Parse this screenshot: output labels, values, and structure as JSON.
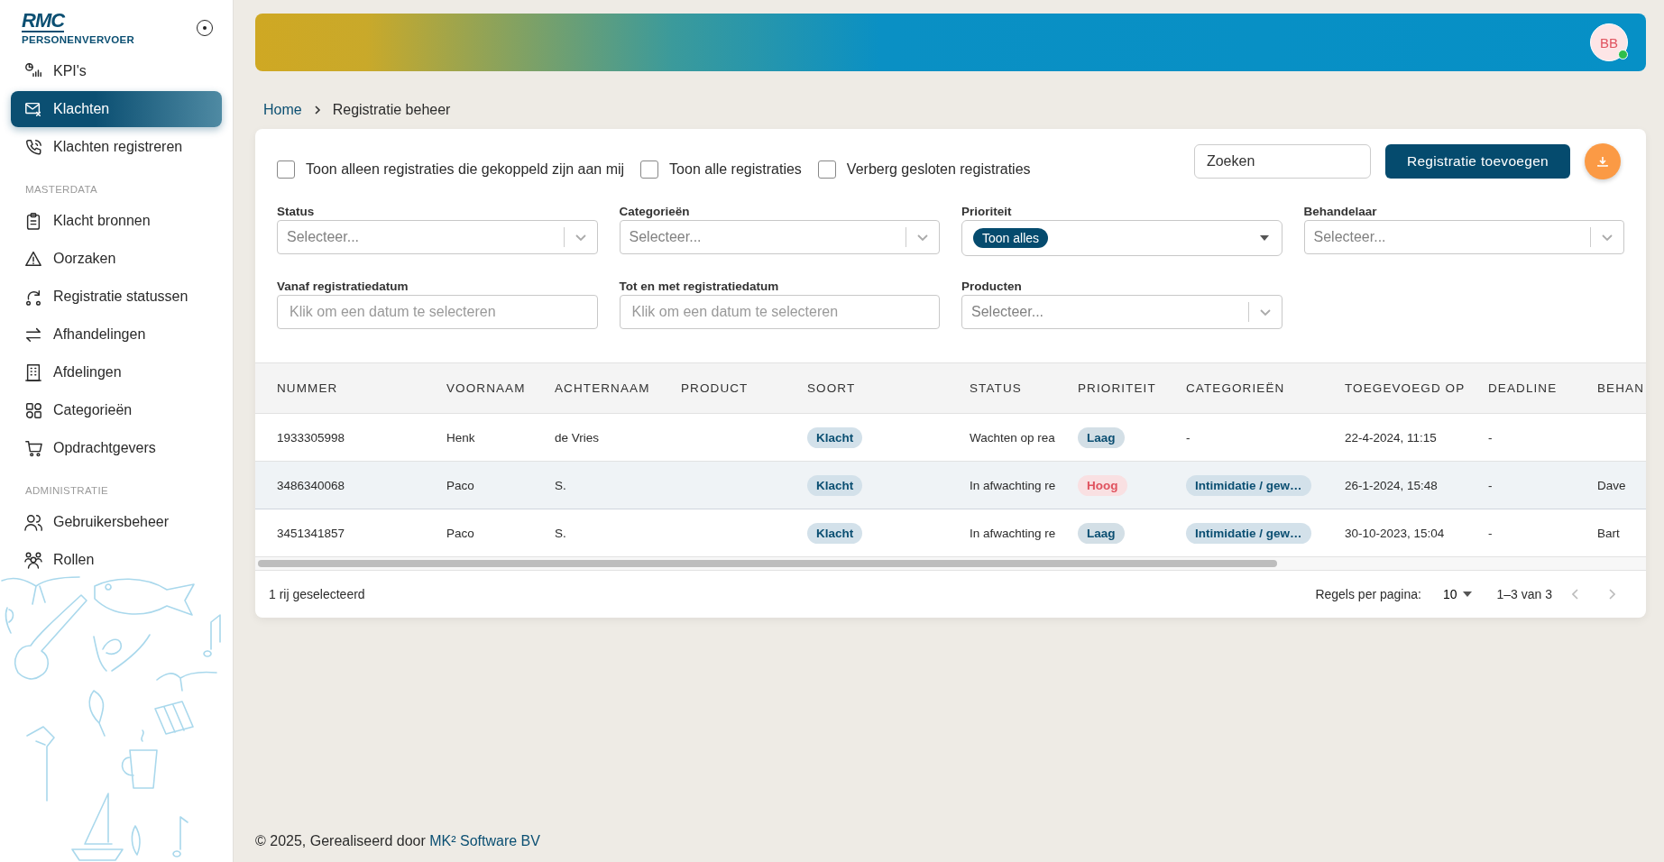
{
  "sidebar": {
    "logo": {
      "title": "RMC",
      "subtitle": "PERSONENVERVOER"
    },
    "nav": [
      {
        "kind": "item",
        "label": "KPI's",
        "selected": false
      },
      {
        "kind": "item",
        "label": "Klachten",
        "selected": true
      },
      {
        "kind": "item",
        "label": "Klachten registreren",
        "selected": false
      },
      {
        "kind": "heading",
        "label": "MASTERDATA"
      },
      {
        "kind": "item",
        "label": "Klacht bronnen",
        "selected": false
      },
      {
        "kind": "item",
        "label": "Oorzaken",
        "selected": false
      },
      {
        "kind": "item",
        "label": "Registratie statussen",
        "selected": false
      },
      {
        "kind": "item",
        "label": "Afhandelingen",
        "selected": false
      },
      {
        "kind": "item",
        "label": "Afdelingen",
        "selected": false
      },
      {
        "kind": "item",
        "label": "Categorieën",
        "selected": false
      },
      {
        "kind": "item",
        "label": "Opdrachtgevers",
        "selected": false
      },
      {
        "kind": "heading",
        "label": "ADMINISTRATIE"
      },
      {
        "kind": "item",
        "label": "Gebruikersbeheer",
        "selected": false
      },
      {
        "kind": "item",
        "label": "Rollen",
        "selected": false
      }
    ]
  },
  "header": {
    "avatar": {
      "initials": "BB",
      "online": true
    }
  },
  "breadcrumb": {
    "home": "Home",
    "current": "Registratie beheer"
  },
  "checkboxes": [
    {
      "label": "Toon alleen registraties die gekoppeld zijn aan mij",
      "checked": false
    },
    {
      "label": "Toon alle registraties",
      "checked": false
    },
    {
      "label": "Verberg gesloten registraties",
      "checked": false
    }
  ],
  "search": {
    "placeholder": "Zoeken"
  },
  "add_button": "Registratie toevoegen",
  "filters": [
    {
      "label": "Status",
      "kind": "select",
      "placeholder": "Selecteer..."
    },
    {
      "label": "Categorieën",
      "kind": "select",
      "placeholder": "Selecteer..."
    },
    {
      "label": "Prioriteit",
      "kind": "tags",
      "tags": [
        "Toon alles"
      ]
    },
    {
      "label": "Behandelaar",
      "kind": "select",
      "placeholder": "Selecteer..."
    },
    {
      "label": "Vanaf registratiedatum",
      "kind": "date",
      "placeholder": "Klik om een datum te selecteren"
    },
    {
      "label": "Tot en met registratiedatum",
      "kind": "date",
      "placeholder": "Klik om een datum te selecteren"
    },
    {
      "label": "Producten",
      "kind": "select",
      "placeholder": "Selecteer..."
    }
  ],
  "table": {
    "columns": [
      "NUMMER",
      "VOORNAAM",
      "ACHTERNAAM",
      "PRODUCT",
      "SOORT",
      "STATUS",
      "PRIORITEIT",
      "CATEGORIEËN",
      "TOEGEVOEGD OP",
      "DEADLINE",
      "BEHAN"
    ],
    "rows": [
      {
        "selected": false,
        "cells": [
          {
            "kind": "text",
            "text": "1933305998"
          },
          {
            "kind": "text",
            "text": "Henk"
          },
          {
            "kind": "text",
            "text": "de Vries"
          },
          {
            "kind": "empty"
          },
          {
            "kind": "chip",
            "text": "Klacht"
          },
          {
            "kind": "text",
            "text": "Wachten op rea"
          },
          {
            "kind": "chip",
            "text": "Laag",
            "color": "#0b4f72"
          },
          {
            "kind": "text",
            "text": "-"
          },
          {
            "kind": "text",
            "text": "22-4-2024, 11:15"
          },
          {
            "kind": "text",
            "text": "-"
          },
          {
            "kind": "empty"
          }
        ]
      },
      {
        "selected": true,
        "cells": [
          {
            "kind": "text",
            "text": "3486340068"
          },
          {
            "kind": "text",
            "text": "Paco"
          },
          {
            "kind": "text",
            "text": "S."
          },
          {
            "kind": "empty"
          },
          {
            "kind": "chip",
            "text": "Klacht"
          },
          {
            "kind": "text",
            "text": "In afwachting re"
          },
          {
            "kind": "chip",
            "text": "Hoog",
            "color": "#e0525e"
          },
          {
            "kind": "chip",
            "text": "Intimidatie / gew…"
          },
          {
            "kind": "text",
            "text": "26-1-2024, 15:48"
          },
          {
            "kind": "text",
            "text": "-"
          },
          {
            "kind": "text",
            "text": "Dave"
          }
        ]
      },
      {
        "selected": false,
        "cells": [
          {
            "kind": "text",
            "text": "3451341857"
          },
          {
            "kind": "text",
            "text": "Paco"
          },
          {
            "kind": "text",
            "text": "S."
          },
          {
            "kind": "empty"
          },
          {
            "kind": "chip",
            "text": "Klacht"
          },
          {
            "kind": "text",
            "text": "In afwachting re"
          },
          {
            "kind": "chip",
            "text": "Laag",
            "color": "#0b4f72"
          },
          {
            "kind": "chip",
            "text": "Intimidatie / gew…"
          },
          {
            "kind": "text",
            "text": "30-10-2023, 15:04"
          },
          {
            "kind": "text",
            "text": "-"
          },
          {
            "kind": "text",
            "text": "Bart"
          }
        ]
      }
    ]
  },
  "table_footer": {
    "selection": "1 rij geselecteerd",
    "rows_per_page_label": "Regels per pagina:",
    "rows_per_page": "10",
    "range": "1–3 van 3"
  },
  "footer": {
    "text": "© 2025, Gerealiseerd door",
    "link": "MK² Software BV"
  }
}
